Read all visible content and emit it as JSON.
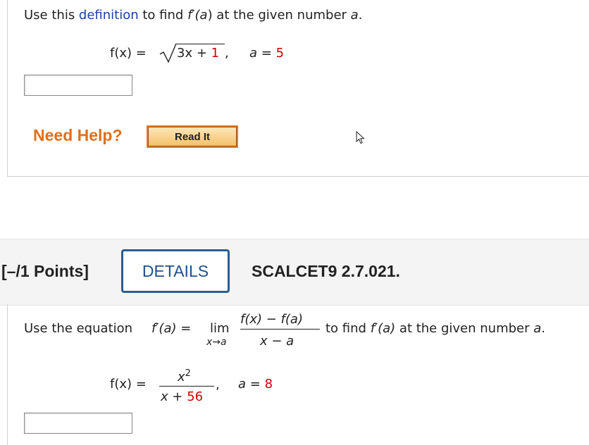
{
  "q1": {
    "intro_pre": "Use this ",
    "intro_link": "definition",
    "intro_post": " to find ",
    "fprime": "f′(",
    "a_var": "a",
    "intro_mid": ") at the given number ",
    "intro_end": ".",
    "func_lhs": "f(x) =",
    "radicand_pre": "3x + ",
    "radicand_num": "1",
    "comma": ",",
    "a_label": "a = ",
    "a_value": "5",
    "answer": "",
    "help_label": "Need Help?",
    "read_label": "Read It"
  },
  "q2": {
    "points": "[–/1 Points]",
    "details": "DETAILS",
    "code": "SCALCET9 2.7.021.",
    "eq_pre": "Use the equation ",
    "eq_fa": "f′(a) =",
    "lim": "lim",
    "lim_sub": "x→a",
    "frac_num": "f(x) − f(a)",
    "frac_den": "x − a",
    "eq_post_pre": "to find ",
    "eq_post_fa": "f′(a)",
    "eq_post_mid": " at the given number ",
    "eq_post_a": "a",
    "eq_post_end": ".",
    "func_lhs": "f(x) =",
    "num_base": "x",
    "num_exp": "2",
    "den_pre": "x + ",
    "den_num": "56",
    "comma": ",",
    "a_label": "a = ",
    "a_value": "8",
    "answer": ""
  },
  "colors": {
    "link": "#1f3fa6",
    "given_value": "#cc0000",
    "need_help": "#e0701a",
    "details_border": "#2c5d8f"
  },
  "icons": {
    "cursor": "mouse-pointer-icon"
  }
}
